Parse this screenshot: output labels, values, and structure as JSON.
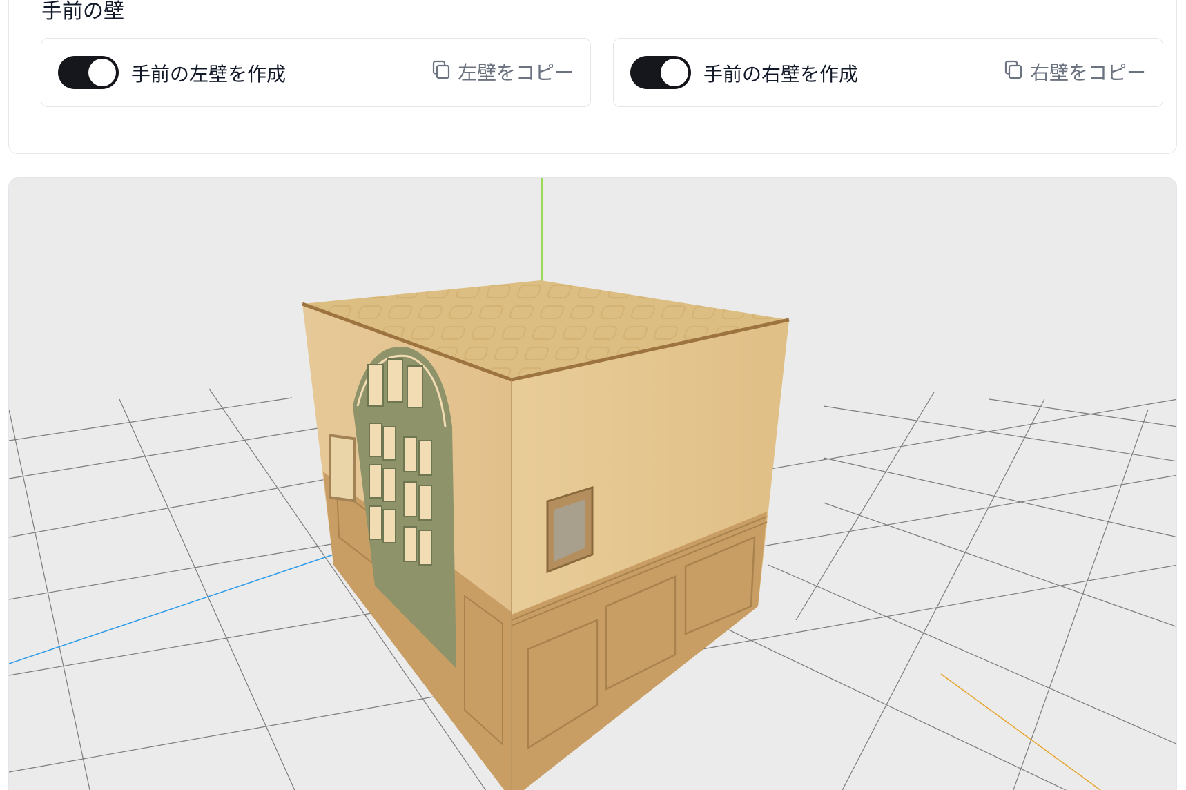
{
  "front_wall": {
    "title": "手前の壁",
    "left": {
      "toggle_on": true,
      "label": "手前の左壁を作成",
      "copy_label": "左壁をコピー"
    },
    "right": {
      "toggle_on": true,
      "label": "手前の右壁を作成",
      "copy_label": "右壁をコピー"
    }
  },
  "icons": {
    "copy": "copy-icon"
  },
  "viewport": {
    "background": "#ebebeb",
    "grid_color": "#7d7d7d",
    "axis_y_color": "#7fd321",
    "axis_x_color": "#2e9be8",
    "axis_z_color": "#e8a52e"
  }
}
